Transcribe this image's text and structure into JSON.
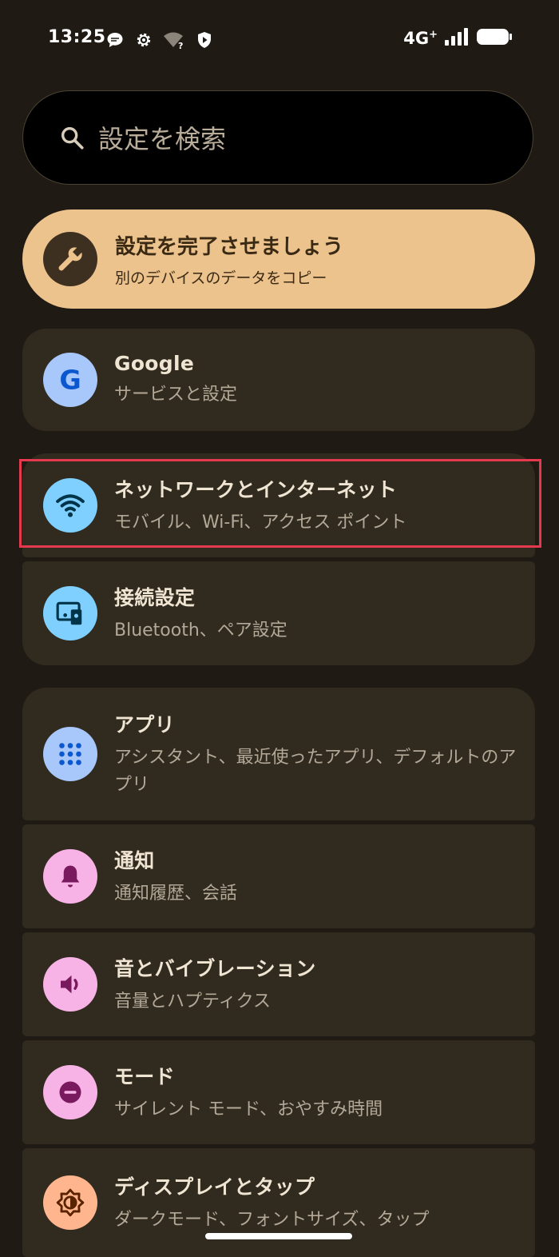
{
  "status_bar": {
    "time": "13:25",
    "network": "4G",
    "network_plus": "+",
    "icons": [
      "chat-bubble-icon",
      "gear-icon",
      "wifi-question-icon",
      "shield-icon",
      "signal-icon",
      "battery-icon"
    ]
  },
  "search": {
    "placeholder": "設定を検索"
  },
  "promo": {
    "title": "設定を完了させましょう",
    "subtitle": "別のデバイスのデータをコピー",
    "background": "#ecc28d",
    "icon": "wrench-icon"
  },
  "settings": [
    {
      "id": "google",
      "title": "Google",
      "subtitle": "サービスと設定",
      "icon": "google-g-icon",
      "icon_bg": "#a8c7fa",
      "icon_fg": "#0b57d0"
    },
    {
      "id": "network",
      "title": "ネットワークとインターネット",
      "subtitle": "モバイル、Wi-Fi、アクセス ポイント",
      "icon": "wifi-icon",
      "icon_bg": "#7fcfff",
      "icon_fg": "#003549",
      "highlighted": true
    },
    {
      "id": "connected",
      "title": "接続設定",
      "subtitle": "Bluetooth、ペア設定",
      "icon": "devices-icon",
      "icon_bg": "#7fcfff",
      "icon_fg": "#003549"
    },
    {
      "id": "apps",
      "title": "アプリ",
      "subtitle": "アシスタント、最近使ったアプリ、デフォルトのアプリ",
      "icon": "apps-grid-icon",
      "icon_bg": "#a8c7fa",
      "icon_fg": "#0b57d0"
    },
    {
      "id": "notifications",
      "title": "通知",
      "subtitle": "通知履歴、会話",
      "icon": "bell-icon",
      "icon_bg": "#f8b3e6",
      "icon_fg": "#7a1a5e"
    },
    {
      "id": "sound",
      "title": "音とバイブレーション",
      "subtitle": "音量とハプティクス",
      "icon": "speaker-icon",
      "icon_bg": "#f8b3e6",
      "icon_fg": "#7a1a5e"
    },
    {
      "id": "modes",
      "title": "モード",
      "subtitle": "サイレント モード、おやすみ時間",
      "icon": "do-not-disturb-icon",
      "icon_bg": "#f8b3e6",
      "icon_fg": "#7a1a5e"
    },
    {
      "id": "display",
      "title": "ディスプレイとタップ",
      "subtitle": "ダークモード、フォントサイズ、タップ",
      "icon": "brightness-icon",
      "icon_bg": "#ffb68e",
      "icon_fg": "#5a2300"
    }
  ],
  "highlight_color": "#e4394f"
}
